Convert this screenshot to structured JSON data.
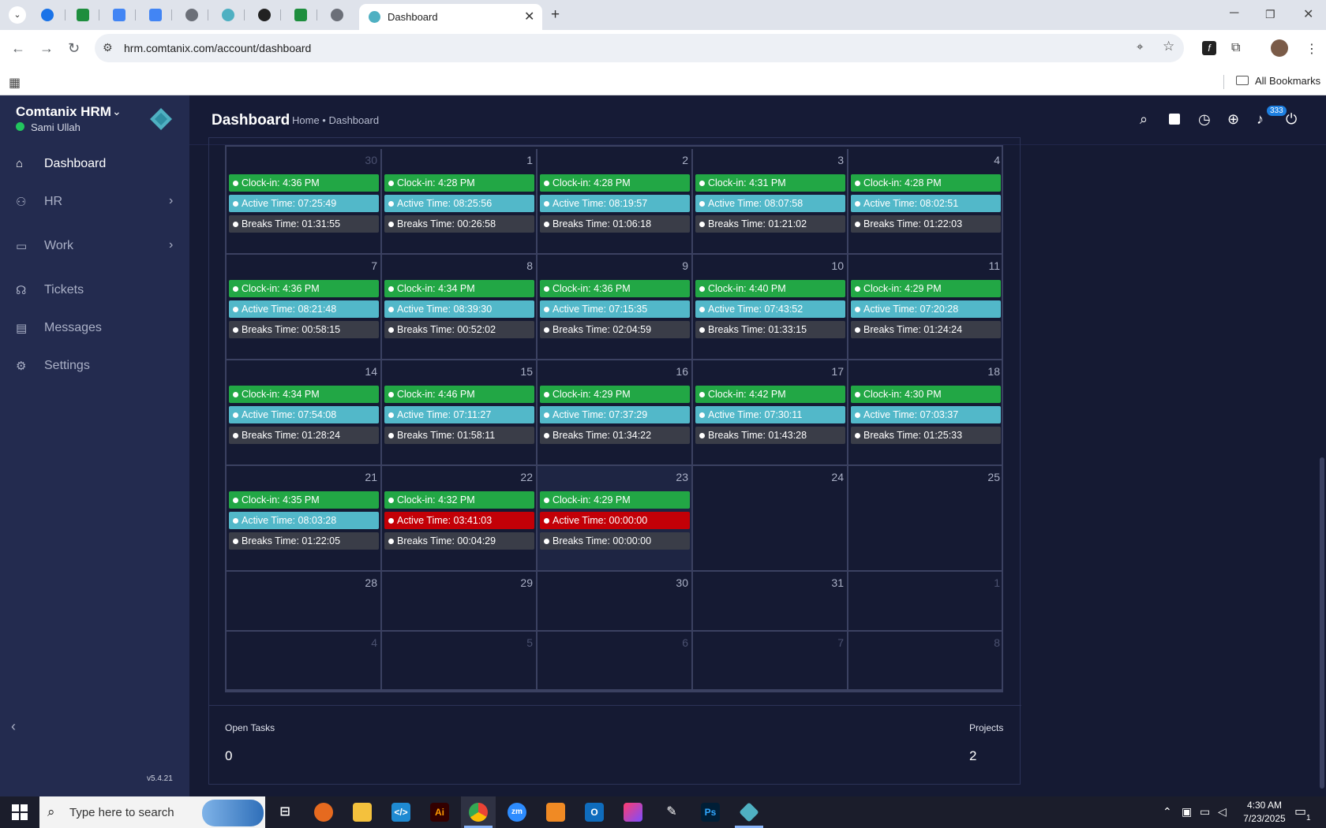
{
  "browser": {
    "active_tab_title": "Dashboard",
    "url": "hrm.comtanix.com/account/dashboard",
    "all_bookmarks": "All Bookmarks"
  },
  "sidebar": {
    "brand": "Comtanix HRM",
    "user": "Sami Ullah",
    "items": [
      {
        "label": "Dashboard",
        "icon": "home-icon"
      },
      {
        "label": "HR",
        "icon": "users-icon"
      },
      {
        "label": "Work",
        "icon": "briefcase-icon"
      },
      {
        "label": "Tickets",
        "icon": "headset-icon"
      },
      {
        "label": "Messages",
        "icon": "message-icon"
      },
      {
        "label": "Settings",
        "icon": "gear-icon"
      }
    ],
    "version": "v5.4.21"
  },
  "header": {
    "title": "Dashboard",
    "breadcrumb": "Home • Dashboard",
    "notification_count": "333"
  },
  "calendar": {
    "weeks": [
      [
        {
          "day": "30",
          "other": true,
          "clock": "Clock-in: 4:36 PM",
          "active": "Active Time: 07:25:49",
          "breaks": "Breaks Time: 01:31:55"
        },
        {
          "day": "1",
          "clock": "Clock-in: 4:28 PM",
          "active": "Active Time: 08:25:56",
          "breaks": "Breaks Time: 00:26:58"
        },
        {
          "day": "2",
          "clock": "Clock-in: 4:28 PM",
          "active": "Active Time: 08:19:57",
          "breaks": "Breaks Time: 01:06:18"
        },
        {
          "day": "3",
          "clock": "Clock-in: 4:31 PM",
          "active": "Active Time: 08:07:58",
          "breaks": "Breaks Time: 01:21:02"
        },
        {
          "day": "4",
          "clock": "Clock-in: 4:28 PM",
          "active": "Active Time: 08:02:51",
          "breaks": "Breaks Time: 01:22:03"
        }
      ],
      [
        {
          "day": "7",
          "clock": "Clock-in: 4:36 PM",
          "active": "Active Time: 08:21:48",
          "breaks": "Breaks Time: 00:58:15"
        },
        {
          "day": "8",
          "clock": "Clock-in: 4:34 PM",
          "active": "Active Time: 08:39:30",
          "breaks": "Breaks Time: 00:52:02"
        },
        {
          "day": "9",
          "clock": "Clock-in: 4:36 PM",
          "active": "Active Time: 07:15:35",
          "breaks": "Breaks Time: 02:04:59"
        },
        {
          "day": "10",
          "clock": "Clock-in: 4:40 PM",
          "active": "Active Time: 07:43:52",
          "breaks": "Breaks Time: 01:33:15"
        },
        {
          "day": "11",
          "clock": "Clock-in: 4:29 PM",
          "active": "Active Time: 07:20:28",
          "breaks": "Breaks Time: 01:24:24"
        }
      ],
      [
        {
          "day": "14",
          "clock": "Clock-in: 4:34 PM",
          "active": "Active Time: 07:54:08",
          "breaks": "Breaks Time: 01:28:24"
        },
        {
          "day": "15",
          "clock": "Clock-in: 4:46 PM",
          "active": "Active Time: 07:11:27",
          "breaks": "Breaks Time: 01:58:11"
        },
        {
          "day": "16",
          "clock": "Clock-in: 4:29 PM",
          "active": "Active Time: 07:37:29",
          "breaks": "Breaks Time: 01:34:22"
        },
        {
          "day": "17",
          "clock": "Clock-in: 4:42 PM",
          "active": "Active Time: 07:30:11",
          "breaks": "Breaks Time: 01:43:28"
        },
        {
          "day": "18",
          "clock": "Clock-in: 4:30 PM",
          "active": "Active Time: 07:03:37",
          "breaks": "Breaks Time: 01:25:33"
        }
      ],
      [
        {
          "day": "21",
          "clock": "Clock-in: 4:35 PM",
          "active": "Active Time: 08:03:28",
          "breaks": "Breaks Time: 01:22:05"
        },
        {
          "day": "22",
          "clock": "Clock-in: 4:32 PM",
          "active": "Active Time: 03:41:03",
          "active_status": "short",
          "breaks": "Breaks Time: 00:04:29"
        },
        {
          "day": "23",
          "today": true,
          "clock": "Clock-in: 4:29 PM",
          "active": "Active Time: 00:00:00",
          "active_status": "short",
          "breaks": "Breaks Time: 00:00:00"
        },
        {
          "day": "24"
        },
        {
          "day": "25"
        }
      ],
      [
        {
          "day": "28"
        },
        {
          "day": "29"
        },
        {
          "day": "30"
        },
        {
          "day": "31"
        },
        {
          "day": "1",
          "other": true
        }
      ],
      [
        {
          "day": "4",
          "other": true
        },
        {
          "day": "5",
          "other": true
        },
        {
          "day": "6",
          "other": true
        },
        {
          "day": "7",
          "other": true
        },
        {
          "day": "8",
          "other": true
        }
      ]
    ]
  },
  "stats": {
    "open_tasks_label": "Open Tasks",
    "open_tasks_value": "0",
    "projects_label": "Projects",
    "projects_value": "2"
  },
  "taskbar": {
    "search_placeholder": "Type here to search",
    "time": "4:30 AM",
    "date": "7/23/2025",
    "notification_count": "1"
  },
  "colors": {
    "clock_in": "#22a745",
    "active_time": "#52b8c9",
    "active_time_short": "#c30007",
    "breaks_time": "#3a3d48",
    "sidebar": "#232b4f",
    "content": "#151a33"
  }
}
